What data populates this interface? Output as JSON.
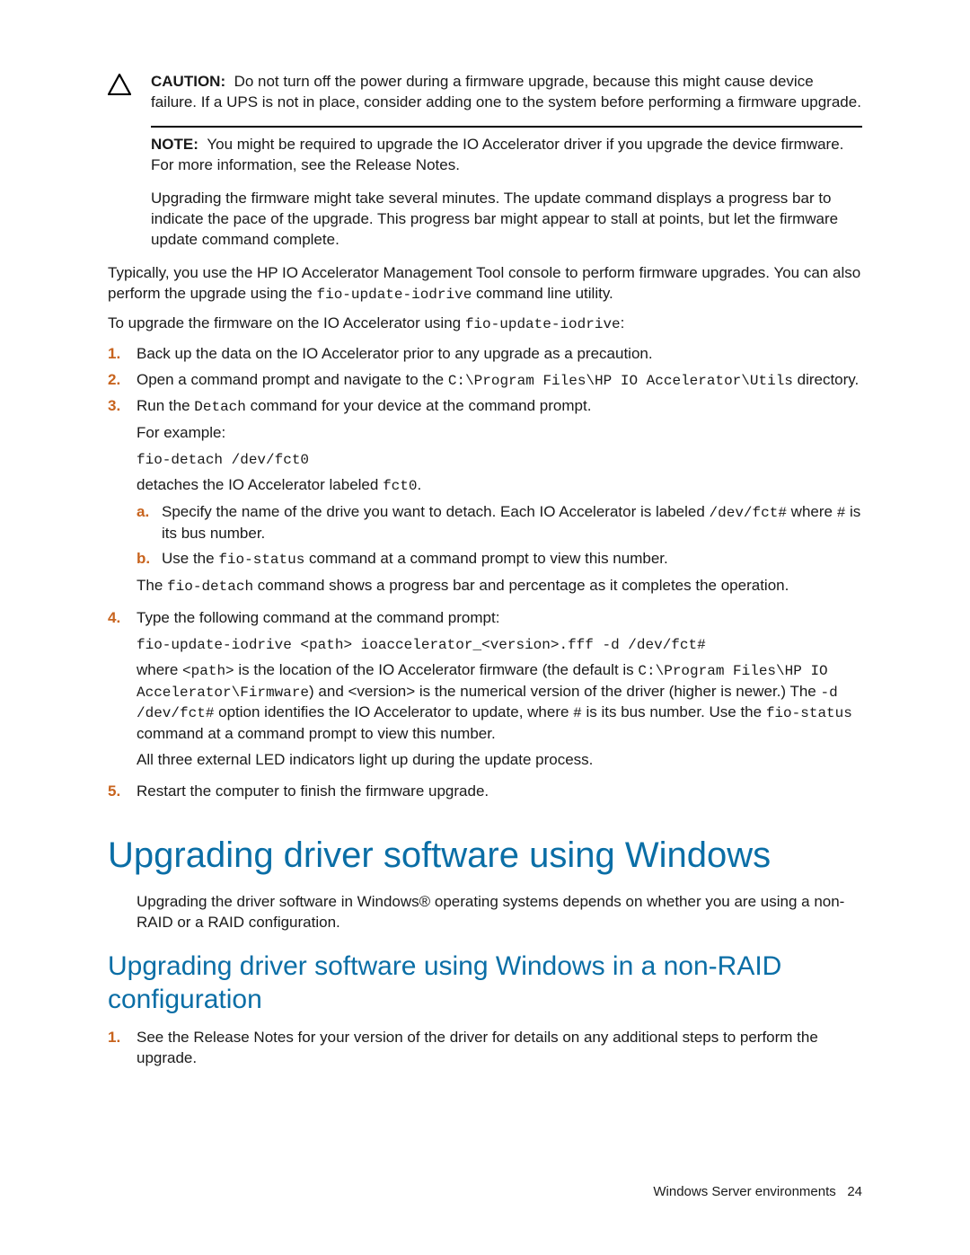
{
  "caution": {
    "lead": "CAUTION:",
    "text": "Do not turn off the power during a firmware upgrade, because this might cause device failure. If a UPS is not in place, consider adding one to the system before performing a firmware upgrade."
  },
  "note": {
    "lead": "NOTE:",
    "text": "You might be required to upgrade the IO Accelerator driver if you upgrade the device firmware. For more information, see the Release Notes."
  },
  "upgrade_info": "Upgrading the firmware might take several minutes. The update command displays a progress bar to indicate the pace of the upgrade. This progress bar might appear to stall at points, but let the firmware update command complete.",
  "typical_intro_pre": "Typically, you use the HP IO Accelerator Management Tool console to perform firmware upgrades. You can also perform the upgrade using the ",
  "typical_intro_code": "fio-update-iodrive",
  "typical_intro_post": " command line utility.",
  "to_upgrade_pre": "To upgrade the firmware on the IO Accelerator using ",
  "to_upgrade_code": "fio-update-iodrive",
  "to_upgrade_post": ":",
  "steps": {
    "s1": {
      "num": "1.",
      "text": "Back up the data on the IO Accelerator prior to any upgrade as a precaution."
    },
    "s2": {
      "num": "2.",
      "pre": "Open a command prompt and navigate to the ",
      "code": "C:\\Program Files\\HP IO Accelerator\\Utils",
      "post": " directory."
    },
    "s3": {
      "num": "3.",
      "pre": "Run the ",
      "code": "Detach",
      "post": " command for your device at the command prompt.",
      "for_example": "For example:",
      "ex_code": "fio-detach /dev/fct0",
      "detach_pre": "detaches the IO Accelerator labeled ",
      "detach_code": "fct0",
      "detach_post": ".",
      "sa": {
        "m": "a.",
        "pre": "Specify the name of the drive you want to detach. Each IO Accelerator is labeled ",
        "code1": "/dev/fct#",
        "mid": " where ",
        "code2": "#",
        "post": " is its bus number."
      },
      "sb": {
        "m": "b.",
        "pre": "Use the ",
        "code": "fio-status",
        "post": " command at a command prompt to view this number."
      },
      "tail_pre": "The ",
      "tail_code": "fio-detach",
      "tail_post": " command shows a progress bar and percentage as it completes the operation."
    },
    "s4": {
      "num": "4.",
      "lead": "Type the following command at the command prompt:",
      "cmd": "fio-update-iodrive <path> ioaccelerator_<version>.fff -d /dev/fct#",
      "p_pre": "where ",
      "p_c1": "<path>",
      "p_mid1": " is the location of the IO Accelerator firmware (the default is ",
      "p_c2": "C:\\Program Files\\HP IO Accelerator\\Firmware",
      "p_mid2": ") and <version> is the numerical version of the driver (higher is newer.) The ",
      "p_c3": "-d /dev/fct#",
      "p_mid3": " option identifies the IO Accelerator to update, where ",
      "p_c4": "#",
      "p_mid4": " is its bus number. Use the ",
      "p_c5": "fio-status",
      "p_post": " command at a command prompt to view this number.",
      "led": "All three external LED indicators light up during the update process."
    },
    "s5": {
      "num": "5.",
      "text": "Restart the computer to finish the firmware upgrade."
    }
  },
  "h1": "Upgrading driver software using Windows",
  "h1_body": "Upgrading the driver software in Windows® operating systems depends on whether you are using a non-RAID or a RAID configuration.",
  "h2": "Upgrading driver software using Windows in a non-RAID configuration",
  "h2_steps": {
    "s1": {
      "num": "1.",
      "text": "See the Release Notes for your version of the driver for details on any additional steps to perform the upgrade."
    }
  },
  "footer": {
    "label": "Windows Server environments",
    "page": "24"
  }
}
